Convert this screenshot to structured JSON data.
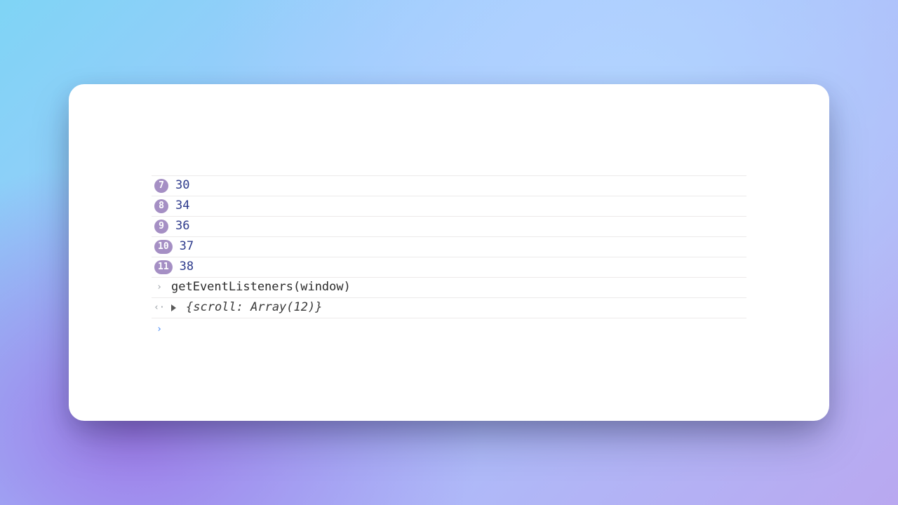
{
  "logs": [
    {
      "count": "7",
      "value": "30"
    },
    {
      "count": "8",
      "value": "34"
    },
    {
      "count": "9",
      "value": "36"
    },
    {
      "count": "10",
      "value": "37"
    },
    {
      "count": "11",
      "value": "38"
    }
  ],
  "input": {
    "command": "getEventListeners(window)"
  },
  "output": {
    "summary": "{scroll: Array(12)}"
  },
  "icons": {
    "input_chevron": "›",
    "output_chevron": "‹·",
    "prompt_chevron": "›"
  }
}
